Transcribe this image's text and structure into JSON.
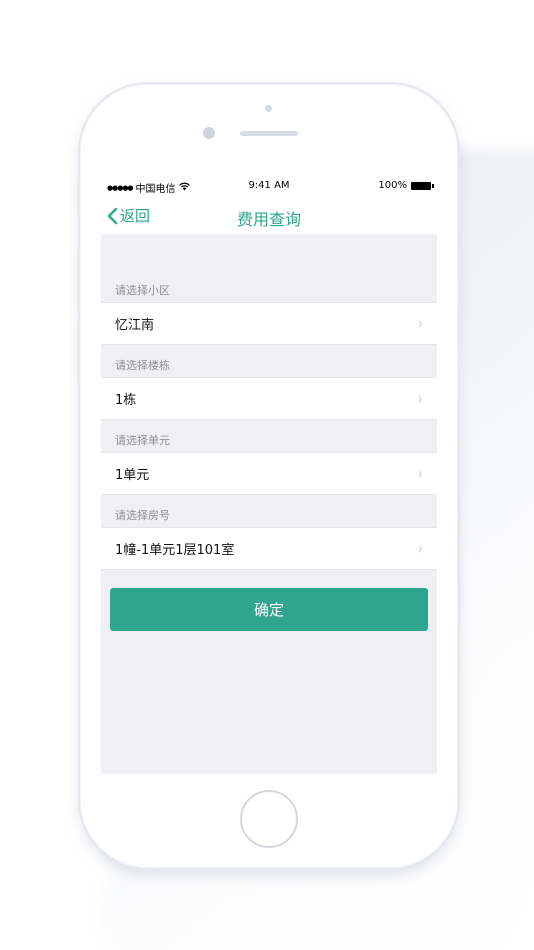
{
  "status_bar": {
    "signal": "●●●●●",
    "carrier": "中国电信",
    "wifi_icon": "wifi-icon",
    "time": "9:41 AM",
    "battery": "100%"
  },
  "nav": {
    "back_label": "返回",
    "title": "费用查询"
  },
  "form": {
    "sections": [
      {
        "label": "请选择小区",
        "value": "忆江南"
      },
      {
        "label": "请选择楼栋",
        "value": "1栋"
      },
      {
        "label": "请选择单元",
        "value": "1单元"
      },
      {
        "label": "请选择房号",
        "value": "1幢-1单元1层101室"
      }
    ],
    "chevron": "›"
  },
  "confirm_label": "确定",
  "colors": {
    "accent": "#2fa58e",
    "background": "#efeff4"
  }
}
